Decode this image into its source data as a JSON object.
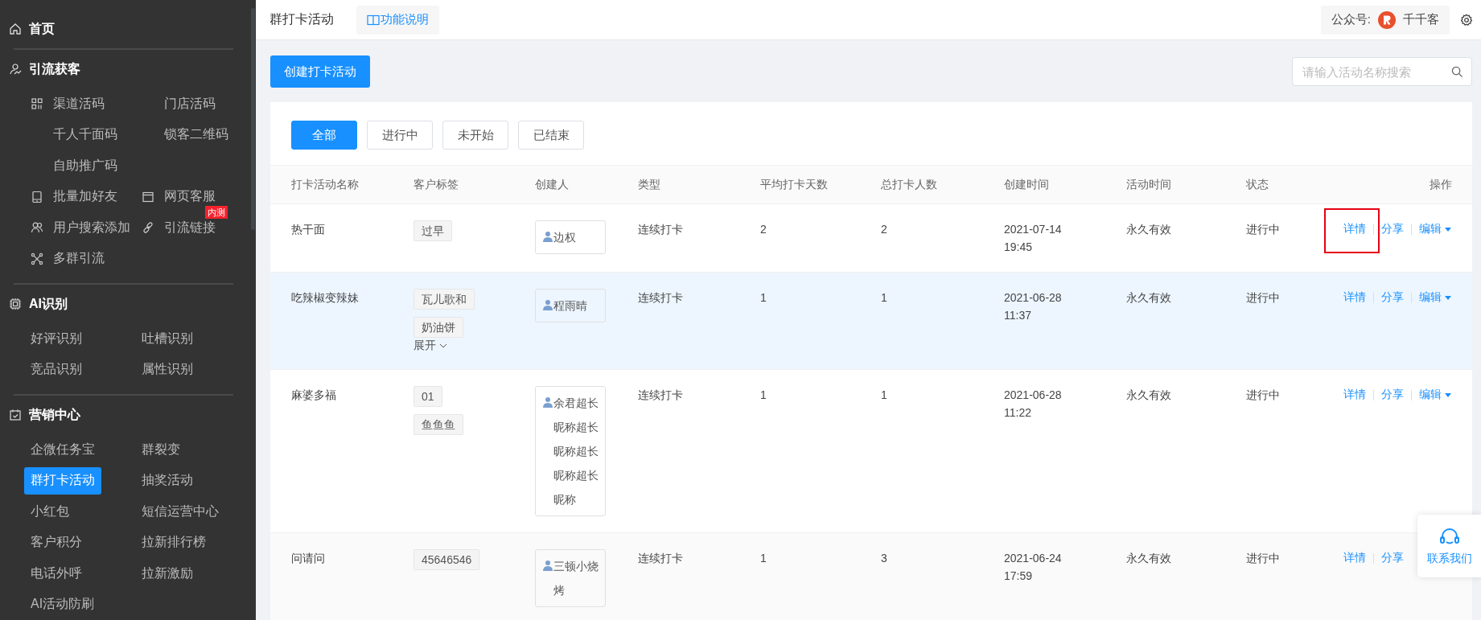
{
  "sidebar": {
    "sections": [
      {
        "title": "首页"
      },
      {
        "title": "引流获客",
        "rows": [
          [
            {
              "label": "渠道活码",
              "selected": false
            },
            {
              "label": "门店活码",
              "selected": false
            }
          ],
          [
            {
              "label": "千人千面码",
              "selected": false
            },
            {
              "label": "锁客二维码",
              "selected": false
            }
          ],
          [
            {
              "label": "自助推广码",
              "selected": false
            }
          ],
          [
            {
              "label": "批量加好友",
              "selected": false
            },
            {
              "label": "网页客服",
              "selected": false,
              "badge": "内测"
            }
          ],
          [
            {
              "label": "用户搜索添加",
              "selected": false
            },
            {
              "label": "引流链接",
              "selected": false
            }
          ],
          [
            {
              "label": "多群引流",
              "selected": false
            }
          ]
        ]
      },
      {
        "title": "AI识别",
        "rows": [
          [
            {
              "label": "好评识别",
              "selected": false
            },
            {
              "label": "吐槽识别",
              "selected": false
            }
          ],
          [
            {
              "label": "竞品识别",
              "selected": false
            },
            {
              "label": "属性识别",
              "selected": false
            }
          ]
        ]
      },
      {
        "title": "营销中心",
        "rows": [
          [
            {
              "label": "企微任务宝",
              "selected": false
            },
            {
              "label": "群裂变",
              "selected": false
            }
          ],
          [
            {
              "label": "群打卡活动",
              "selected": true
            },
            {
              "label": "抽奖活动",
              "selected": false
            }
          ],
          [
            {
              "label": "小红包",
              "selected": false
            },
            {
              "label": "短信运营中心",
              "selected": false
            }
          ],
          [
            {
              "label": "客户积分",
              "selected": false
            },
            {
              "label": "拉新排行榜",
              "selected": false
            }
          ],
          [
            {
              "label": "电话外呼",
              "selected": false
            },
            {
              "label": "拉新激励",
              "selected": false
            }
          ],
          [
            {
              "label": "AI活动防刷",
              "selected": false
            }
          ]
        ]
      }
    ]
  },
  "header": {
    "title": "群打卡活动",
    "help_button": "功能说明",
    "account_label": "公众号:",
    "account_name": "千千客"
  },
  "toolbar": {
    "create_button": "创建打卡活动",
    "search": {
      "placeholder": "请输入活动名称搜索"
    }
  },
  "filters": [
    {
      "label": "全部",
      "selected": true
    },
    {
      "label": "进行中",
      "selected": false
    },
    {
      "label": "未开始",
      "selected": false
    },
    {
      "label": "已结束",
      "selected": false
    }
  ],
  "table": {
    "columns": [
      "打卡活动名称",
      "客户标签",
      "创建人",
      "类型",
      "平均打卡天数",
      "总打卡人数",
      "创建时间",
      "活动时间",
      "状态",
      "操作"
    ],
    "rows": [
      {
        "name": "热干面",
        "tags": [
          "过早"
        ],
        "creator": "边权",
        "type": "连续打卡",
        "avg_days": "2",
        "total": "2",
        "created_date": "2021-07-14",
        "created_time": "19:45",
        "period": "永久有效",
        "status": "进行中",
        "hovered": false,
        "actions": [
          {
            "label": "详情",
            "kind": "link",
            "highlighted": true
          },
          {
            "label": "分享",
            "kind": "link",
            "highlighted": false
          },
          {
            "label": "编辑",
            "kind": "dropdown",
            "highlighted": false
          }
        ]
      },
      {
        "name": "吃辣椒变辣妹",
        "tags": [
          "瓦儿歌和",
          "奶油饼"
        ],
        "expand": "展开",
        "creator": "程雨晴",
        "type": "连续打卡",
        "avg_days": "1",
        "total": "1",
        "created_date": "2021-06-28",
        "created_time": "11:37",
        "period": "永久有效",
        "status": "进行中",
        "hovered": true,
        "actions": [
          {
            "label": "详情",
            "kind": "link",
            "highlighted": false
          },
          {
            "label": "分享",
            "kind": "link",
            "highlighted": false
          },
          {
            "label": "编辑",
            "kind": "dropdown",
            "highlighted": false
          }
        ]
      },
      {
        "name": "麻婆多福",
        "tags": [
          "01",
          "鱼鱼鱼"
        ],
        "creator": "余君超长昵称超长昵称超长昵称超长昵称",
        "type": "连续打卡",
        "avg_days": "1",
        "total": "1",
        "created_date": "2021-06-28",
        "created_time": "11:22",
        "period": "永久有效",
        "status": "进行中",
        "hovered": false,
        "actions": [
          {
            "label": "详情",
            "kind": "link",
            "highlighted": false
          },
          {
            "label": "分享",
            "kind": "link",
            "highlighted": false
          },
          {
            "label": "编辑",
            "kind": "dropdown",
            "highlighted": false
          }
        ]
      },
      {
        "name": "问请问",
        "tags": [
          "45646546"
        ],
        "creator": "三顿小烧烤",
        "type": "连续打卡",
        "avg_days": "1",
        "total": "3",
        "created_date": "2021-06-24",
        "created_time": "17:59",
        "period": "永久有效",
        "status": "进行中",
        "hovered": false,
        "actions": [
          {
            "label": "详情",
            "kind": "link",
            "highlighted": false
          },
          {
            "label": "分享",
            "kind": "link",
            "highlighted": false
          }
        ]
      }
    ]
  },
  "contact_button": {
    "label": "联系我们"
  }
}
